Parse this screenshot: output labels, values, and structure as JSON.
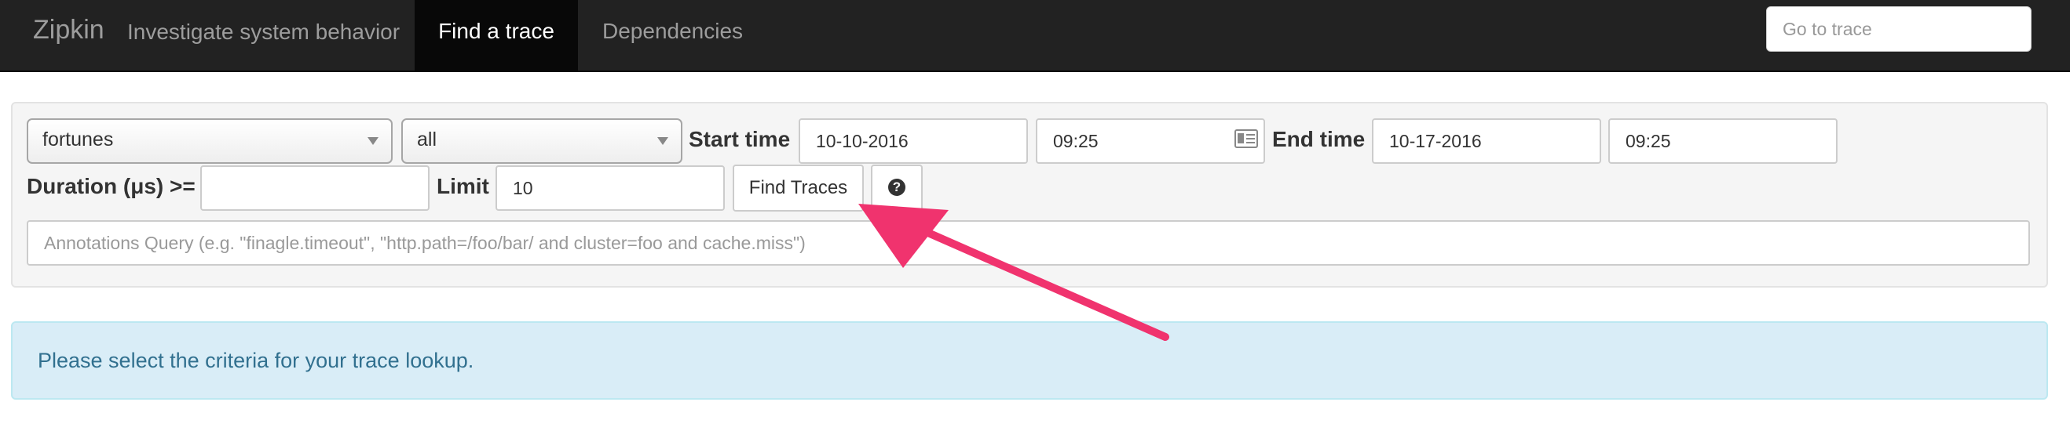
{
  "navbar": {
    "brand": "Zipkin",
    "tagline": "Investigate system behavior",
    "nav_find": "Find a trace",
    "nav_dependencies": "Dependencies",
    "goto_placeholder": "Go to trace"
  },
  "search": {
    "service_value": "fortunes",
    "span_value": "all",
    "start_label": "Start time",
    "start_date": "10-10-2016",
    "start_time": "09:25",
    "end_label": "End time",
    "end_date": "10-17-2016",
    "end_time": "09:25",
    "duration_label": "Duration (μs) >=",
    "duration_value": "",
    "limit_label": "Limit",
    "limit_value": "10",
    "find_button": "Find Traces",
    "help_icon": "?",
    "annotations_placeholder": "Annotations Query (e.g. \"finagle.timeout\", \"http.path=/foo/bar/ and cluster=foo and cache.miss\")"
  },
  "alert": {
    "message": "Please select the criteria for your trace lookup."
  },
  "icons": {
    "calendar": "calendar-icon",
    "help": "question-circle-icon",
    "caret": "chevron-down-icon",
    "annotation_arrow": "arrow-icon"
  },
  "colors": {
    "navbar_bg": "#222222",
    "active_nav_bg": "#080808",
    "alert_bg": "#d9edf7",
    "alert_text": "#31708f",
    "arrow": "#f0336e"
  }
}
